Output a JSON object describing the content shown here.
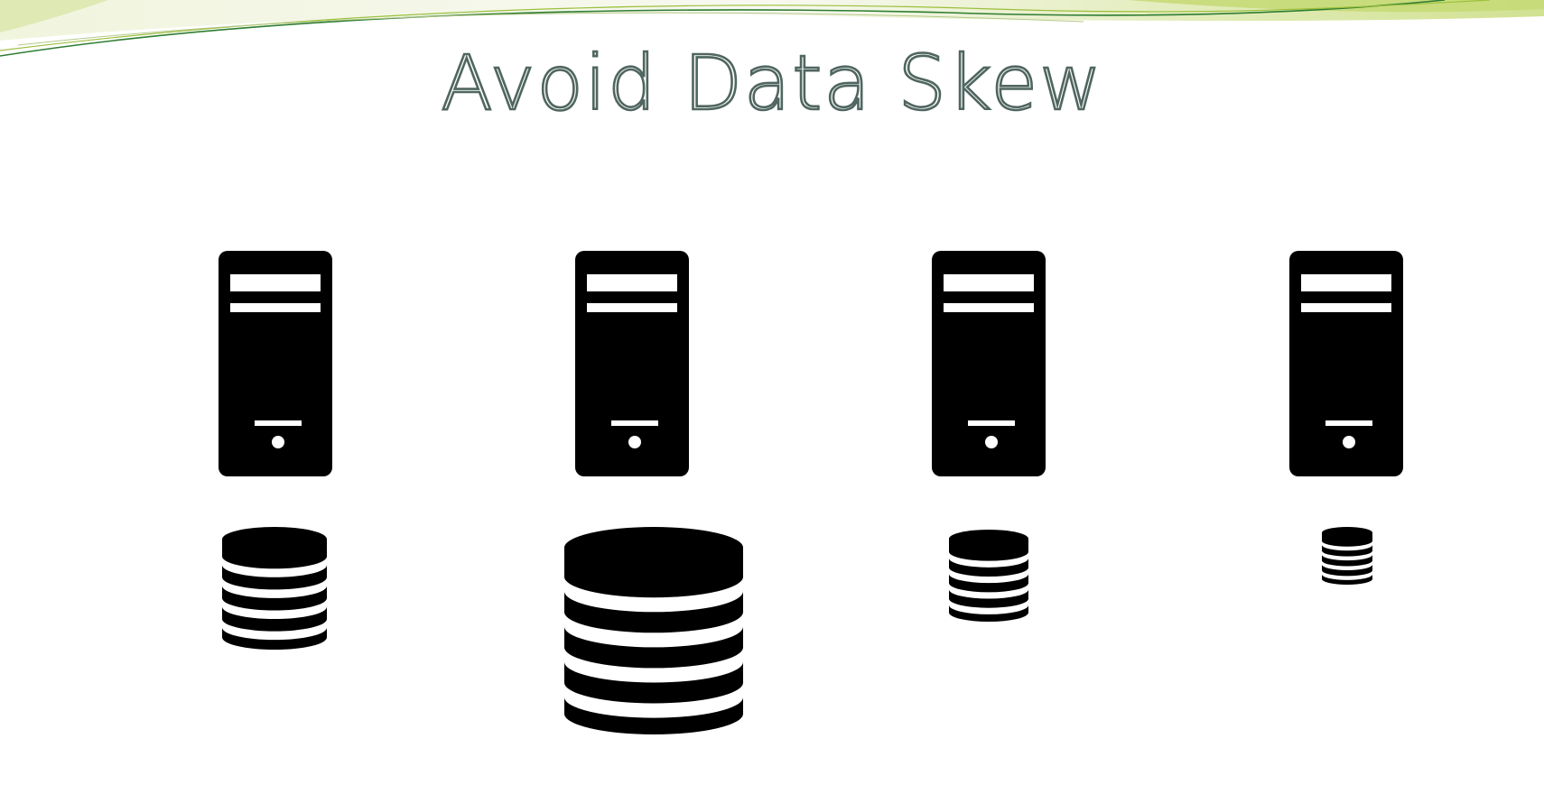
{
  "slide": {
    "title": "Avoid Data Skew"
  },
  "theme": {
    "title_outline": "#506660",
    "icon_fill": "#000000",
    "accent_green_dark": "#2e7d32",
    "accent_green_light": "#c8d97a"
  },
  "nodes": [
    {
      "server_icon": "server-tower-icon",
      "database_icon": "database-icon",
      "relative_data_size": "medium"
    },
    {
      "server_icon": "server-tower-icon",
      "database_icon": "database-icon",
      "relative_data_size": "large"
    },
    {
      "server_icon": "server-tower-icon",
      "database_icon": "database-icon",
      "relative_data_size": "small"
    },
    {
      "server_icon": "server-tower-icon",
      "database_icon": "database-icon",
      "relative_data_size": "smallest"
    }
  ]
}
